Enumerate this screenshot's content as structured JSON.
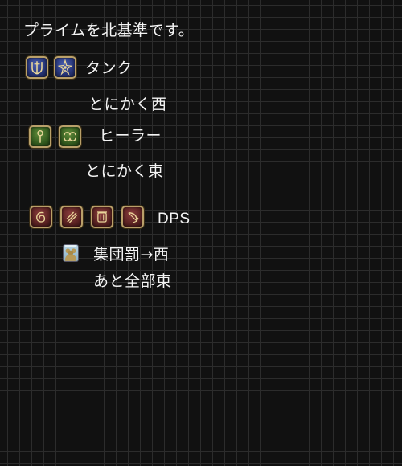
{
  "heading": "プライムを北基準です。",
  "tank": {
    "label": "タンク",
    "note": "とにかく西",
    "icons": [
      "paladin-icon",
      "dark-knight-icon"
    ]
  },
  "healer": {
    "label": "ヒーラー",
    "note": "とにかく東",
    "icons": [
      "white-mage-icon",
      "astrologian-icon"
    ]
  },
  "dps": {
    "label": "DPS",
    "icons": [
      "monk-icon",
      "dragoon-icon",
      "bard-icon",
      "machinist-icon"
    ],
    "party_icon": "party-members-icon",
    "line1": "集団罰→西",
    "line2": "あと全部東"
  },
  "colors": {
    "tank": "#263476",
    "healer": "#335a1e",
    "dps": "#5a2222",
    "icon_border": "#b9a06a",
    "background": "#111111",
    "grid": "#2c2c2c"
  }
}
